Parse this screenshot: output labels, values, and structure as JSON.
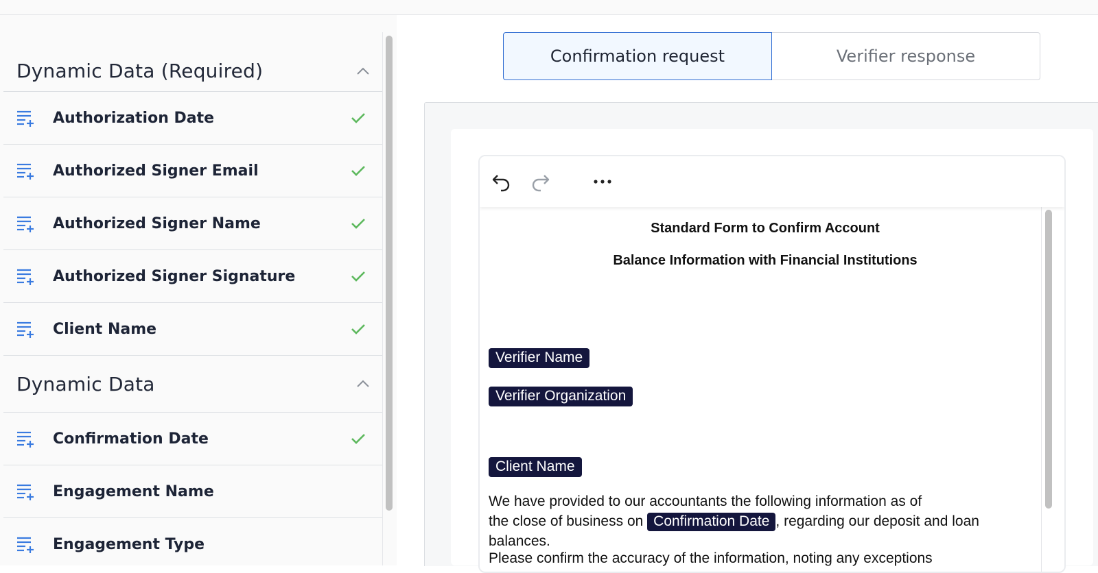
{
  "sidebar": {
    "sections": [
      {
        "title": "Dynamic Data (Required)",
        "items": [
          {
            "label": "Authorization Date",
            "done": true
          },
          {
            "label": "Authorized Signer Email",
            "done": true
          },
          {
            "label": "Authorized Signer Name",
            "done": true
          },
          {
            "label": "Authorized Signer Signature",
            "done": true
          },
          {
            "label": "Client Name",
            "done": true
          }
        ]
      },
      {
        "title": "Dynamic Data",
        "items": [
          {
            "label": "Confirmation Date",
            "done": true
          },
          {
            "label": "Engagement Name",
            "done": false
          },
          {
            "label": "Engagement Type",
            "done": false
          }
        ]
      }
    ],
    "icons": {
      "item": "list-add-icon",
      "done": "check-icon",
      "collapse": "chevron-up-icon"
    },
    "colors": {
      "icon": "#3a7be0",
      "check": "#5cb85c"
    }
  },
  "tabs": [
    {
      "label": "Confirmation request",
      "active": true
    },
    {
      "label": "Verifier response",
      "active": false
    }
  ],
  "toolbar": {
    "icons": [
      "undo-icon",
      "redo-icon",
      "more-icon"
    ]
  },
  "document": {
    "title_line1": "Standard Form to Confirm Account",
    "title_line2": "Balance Information with Financial Institutions",
    "fields": {
      "verifier_name": "Verifier Name",
      "verifier_org": "Verifier Organization",
      "client_name": "Client Name",
      "confirmation_date": "Confirmation Date"
    },
    "para1_line1": "We have provided to our accountants the following information as of",
    "para1_line2_pre": "the close of business on ",
    "para1_line2_post": ", regarding our deposit and loan",
    "para1_line3": "balances.",
    "para2_line1": "Please confirm the accuracy of the information, noting any exceptions"
  },
  "colors": {
    "accent": "#2c6ad1",
    "pill": "#14163d"
  }
}
